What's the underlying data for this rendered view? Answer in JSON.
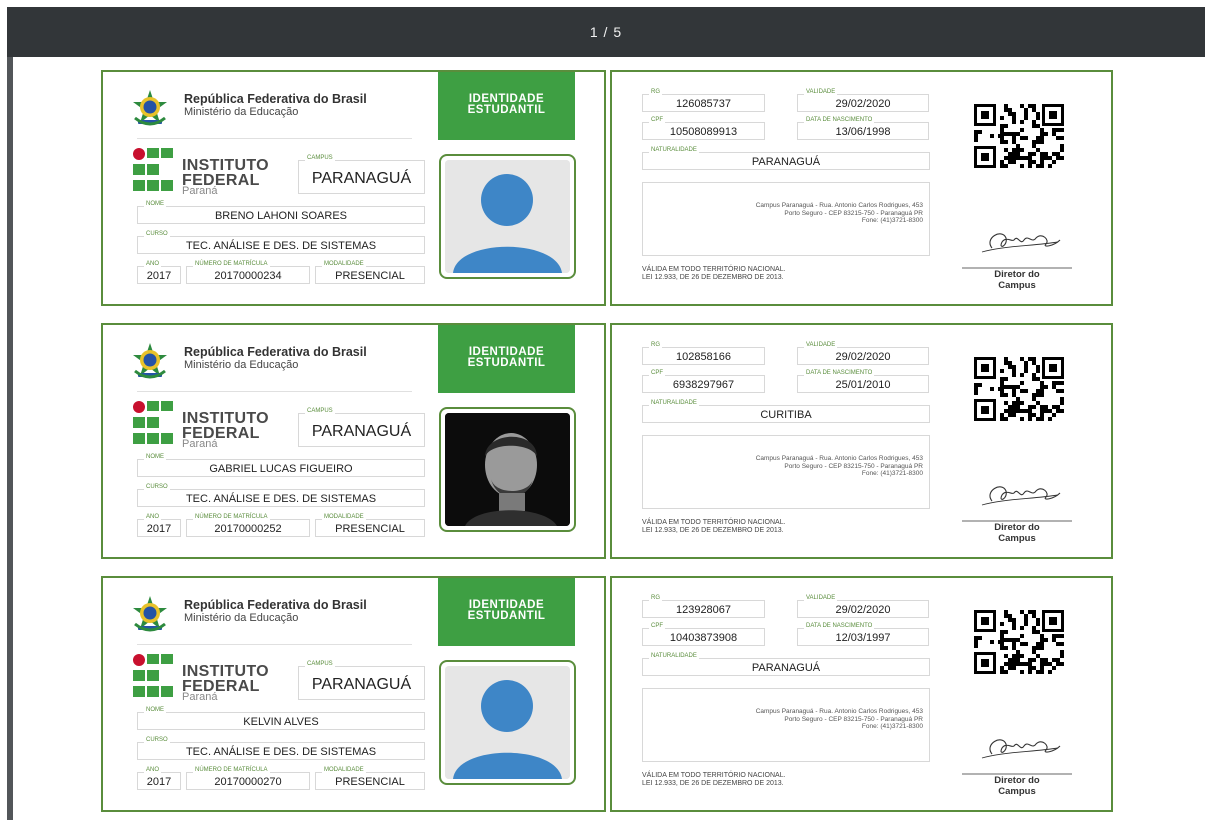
{
  "viewer": {
    "page_indicator": "1 / 5"
  },
  "card_template": {
    "gov_title": "República Federativa do Brasil",
    "gov_subtitle": "Ministério da Educação",
    "badge_line1": "IDENTIDADE",
    "badge_line2": "ESTUDANTIL",
    "institute_line1": "INSTITUTO",
    "institute_line2": "FEDERAL",
    "institute_line3": "Paraná",
    "labels": {
      "campus": "CAMPUS",
      "name": "NOME",
      "course": "CURSO",
      "year": "ANO",
      "enrollment": "NÚMERO DE MATRÍCULA",
      "modality": "MODALIDADE",
      "rg": "RG",
      "validity": "VALIDADE",
      "cpf": "CPF",
      "birth_date": "DATA DE NASCIMENTO",
      "birthplace": "NATURALIDADE"
    },
    "address_line1": "Campus Paranaguá - Rua. Antonio Carlos Rodrigues, 453",
    "address_line2": "Porto Seguro - CEP 83215-750 - Paranaguá PR",
    "address_line3": "Fone: (41)3721-8300",
    "validity_line1": "VÁLIDA EM TODO TERRITÓRIO NACIONAL.",
    "validity_line2": "LEI 12.933, DE 26 DE DEZEMBRO DE 2013.",
    "director_line1": "Diretor do",
    "director_line2": "Campus"
  },
  "cards": [
    {
      "campus": "PARANAGUÁ",
      "name": "BRENO LAHONI SOARES",
      "course": "TEC. ANÁLISE E DES. DE SISTEMAS",
      "year": "2017",
      "enrollment": "20170000234",
      "modality": "PRESENCIAL",
      "rg": "126085737",
      "validity": "29/02/2020",
      "cpf": "10508089913",
      "birth_date": "13/06/1998",
      "birthplace": "PARANAGUÁ",
      "photo": "placeholder-avatar"
    },
    {
      "campus": "PARANAGUÁ",
      "name": "GABRIEL LUCAS FIGUEIRO",
      "course": "TEC. ANÁLISE E DES. DE SISTEMAS",
      "year": "2017",
      "enrollment": "20170000252",
      "modality": "PRESENCIAL",
      "rg": "102858166",
      "validity": "29/02/2020",
      "cpf": "6938297967",
      "birth_date": "25/01/2010",
      "birthplace": "CURITIBA",
      "photo": "student-photo"
    },
    {
      "campus": "PARANAGUÁ",
      "name": "KELVIN ALVES",
      "course": "TEC. ANÁLISE E DES. DE SISTEMAS",
      "year": "2017",
      "enrollment": "20170000270",
      "modality": "PRESENCIAL",
      "rg": "123928067",
      "validity": "29/02/2020",
      "cpf": "10403873908",
      "birth_date": "12/03/1997",
      "birthplace": "PARANAGUÁ",
      "photo": "placeholder-avatar"
    }
  ],
  "colors": {
    "brand_green": "#3e9f43",
    "border_green": "#5a8d3c",
    "if_red": "#c8102e",
    "avatar_blue": "#3e86c7",
    "toolbar": "#323639"
  }
}
